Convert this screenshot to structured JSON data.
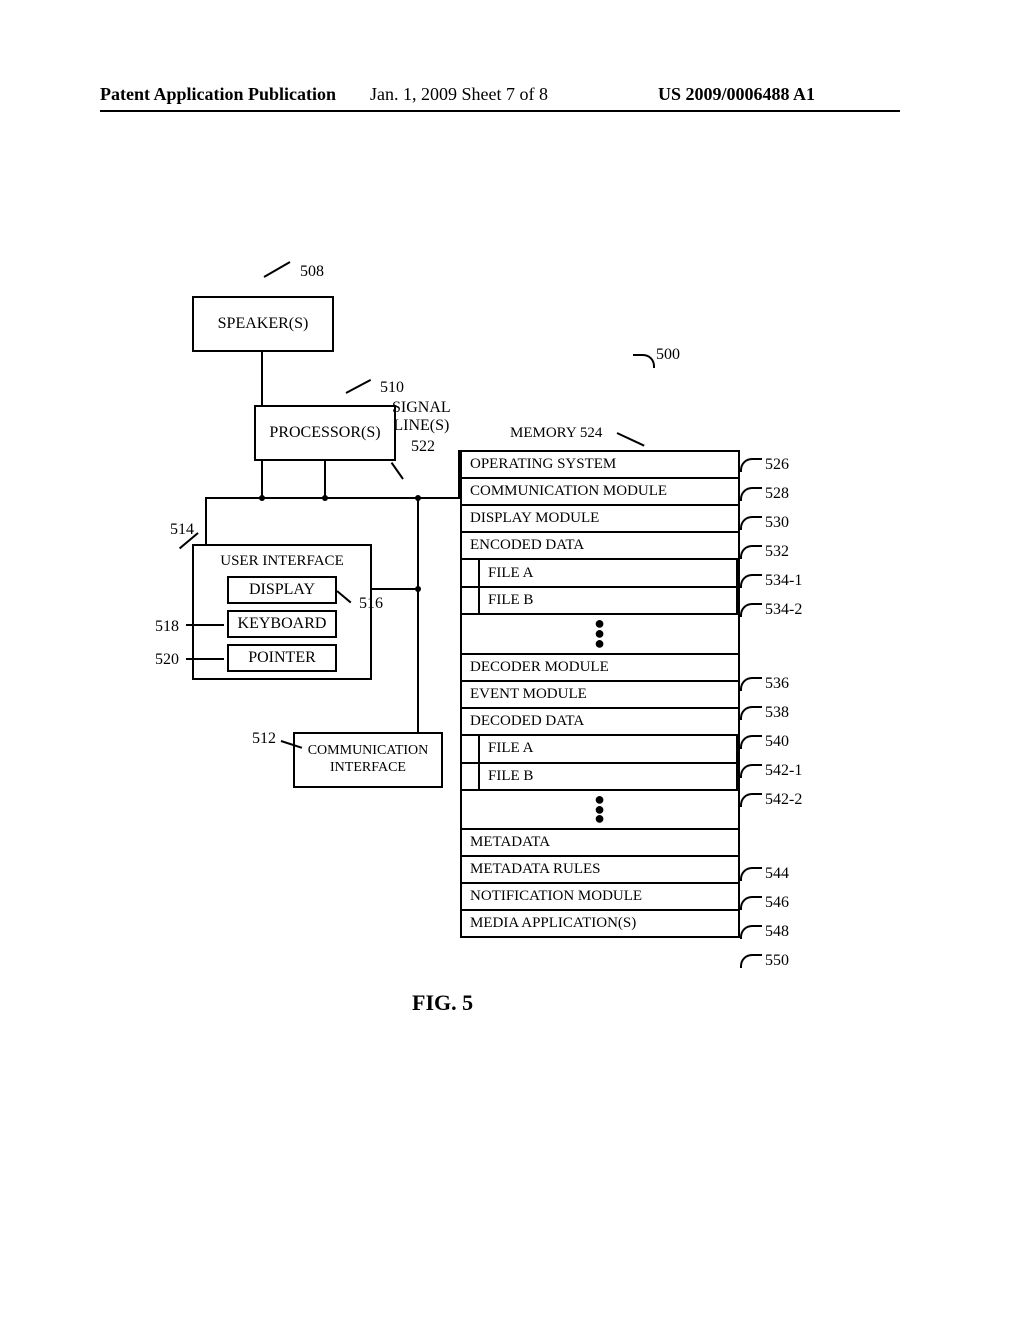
{
  "header": {
    "left": "Patent Application Publication",
    "mid": "Jan. 1, 2009   Sheet 7 of 8",
    "right": "US 2009/0006488 A1"
  },
  "refs": {
    "system": "500",
    "speakers": "508",
    "processors": "510",
    "comm_if": "512",
    "ui": "514",
    "display": "516",
    "keyboard": "518",
    "pointer": "520",
    "signal_lines": "522",
    "memory": "524",
    "os": "526",
    "comm_mod": "528",
    "disp_mod": "530",
    "enc_data": "532",
    "enc_a": "534-1",
    "enc_b": "534-2",
    "decoder": "536",
    "event": "538",
    "dec_data": "540",
    "dec_a": "542-1",
    "dec_b": "542-2",
    "metadata": "544",
    "md_rules": "546",
    "notif": "548",
    "media": "550"
  },
  "labels": {
    "speakers": "SPEAKER(S)",
    "processors": "PROCESSOR(S)",
    "signal_lines": "SIGNAL\nLINE(S)",
    "memory_title": "MEMORY 524",
    "user_interface": "USER INTERFACE",
    "display": "DISPLAY",
    "keyboard": "KEYBOARD",
    "pointer": "POINTER",
    "comm_if": "COMMUNICATION\nINTERFACE"
  },
  "mem": {
    "r0": "OPERATING SYSTEM",
    "r1": "COMMUNICATION MODULE",
    "r2": "DISPLAY MODULE",
    "r3": "ENCODED DATA",
    "r3a": "FILE A",
    "r3b": "FILE B",
    "r4": "DECODER MODULE",
    "r5": "EVENT MODULE",
    "r6": "DECODED DATA",
    "r6a": "FILE A",
    "r6b": "FILE B",
    "r7": "METADATA",
    "r8": "METADATA RULES",
    "r9": "NOTIFICATION MODULE",
    "r10": "MEDIA APPLICATION(S)"
  },
  "figure": "FIG. 5"
}
